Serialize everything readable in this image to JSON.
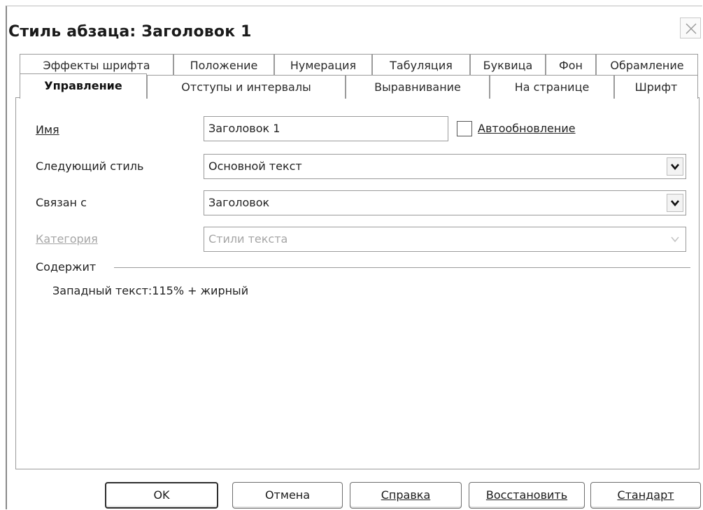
{
  "window": {
    "title": "Стиль абзаца: Заголовок 1"
  },
  "tabs": {
    "row1": [
      "Эффекты шрифта",
      "Положение",
      "Нумерация",
      "Табуляция",
      "Буквица",
      "Фон",
      "Обрамление"
    ],
    "row2": [
      "Управление",
      "Отступы и интервалы",
      "Выравнивание",
      "На странице",
      "Шрифт"
    ],
    "active": "Управление"
  },
  "form": {
    "name_label": "Имя",
    "name_value": "Заголовок 1",
    "autoupdate_label": "Автообновление",
    "autoupdate_checked": false,
    "next_style_label": "Следующий стиль",
    "next_style_value": "Основной текст",
    "linked_label": "Связан с",
    "linked_value": "Заголовок",
    "category_label": "Категория",
    "category_value": "Стили текста"
  },
  "contains": {
    "header": "Содержит",
    "text": "Западный текст:115% + жирный"
  },
  "buttons": {
    "ok": "OK",
    "cancel": "Отмена",
    "help": "Справка",
    "reset": "Восстановить",
    "standard": "Стандарт"
  },
  "icons": {
    "close": "close-icon",
    "dropdown": "chevron-down-icon"
  }
}
